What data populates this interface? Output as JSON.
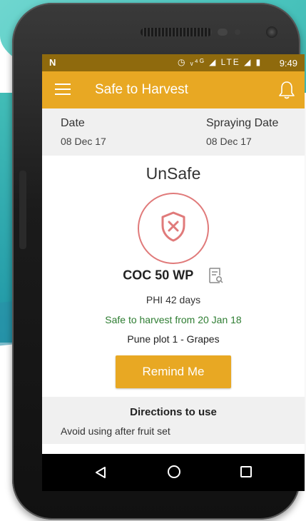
{
  "statusbar": {
    "left_icon": "N",
    "icons": "◷ ᵥ⁴ᴳ ◢ LTE ◢ ▮",
    "time": "9:49"
  },
  "appbar": {
    "title": "Safe to Harvest",
    "menu_icon": "hamburger-menu-icon",
    "notification_icon": "bell-icon"
  },
  "dates": {
    "date_label": "Date",
    "date_value": "08 Dec 17",
    "spraying_label": "Spraying Date",
    "spraying_value": "08 Dec 17"
  },
  "result": {
    "status": "UnSafe",
    "status_icon": "shield-x-icon",
    "product": "COC 50 WP",
    "product_icon": "document-search-icon",
    "phi": "PHI 42 days",
    "safe_from": "Safe to harvest from 20 Jan 18",
    "plot": "Pune plot 1 - Grapes"
  },
  "actions": {
    "remind_label": "Remind Me"
  },
  "directions": {
    "title": "Directions to use",
    "text": "Avoid using after fruit set"
  },
  "colors": {
    "accent": "#e8a823",
    "status_bar": "#8f6a0d",
    "unsafe_red": "#e07a7a",
    "safe_green": "#2e7d32"
  }
}
